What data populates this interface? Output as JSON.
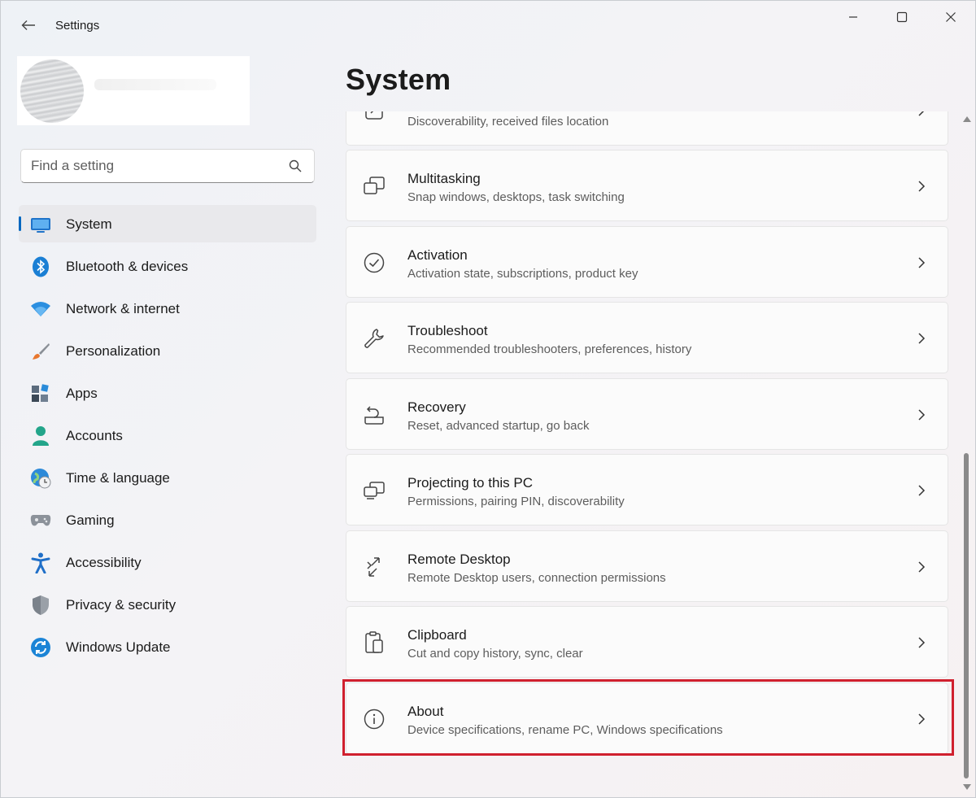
{
  "window": {
    "app_title": "Settings"
  },
  "search": {
    "placeholder": "Find a setting"
  },
  "nav": {
    "items": [
      {
        "label": "System",
        "icon": "system-icon",
        "selected": true
      },
      {
        "label": "Bluetooth & devices",
        "icon": "bluetooth-icon"
      },
      {
        "label": "Network & internet",
        "icon": "wifi-icon"
      },
      {
        "label": "Personalization",
        "icon": "brush-icon"
      },
      {
        "label": "Apps",
        "icon": "apps-icon"
      },
      {
        "label": "Accounts",
        "icon": "accounts-icon"
      },
      {
        "label": "Time & language",
        "icon": "time-language-icon"
      },
      {
        "label": "Gaming",
        "icon": "gamepad-icon"
      },
      {
        "label": "Accessibility",
        "icon": "accessibility-icon"
      },
      {
        "label": "Privacy & security",
        "icon": "shield-icon"
      },
      {
        "label": "Windows Update",
        "icon": "windows-update-icon"
      }
    ]
  },
  "main": {
    "title": "System",
    "cards": [
      {
        "title": "",
        "subtitle": "Discoverability, received files location",
        "icon": "nearby-sharing-icon"
      },
      {
        "title": "Multitasking",
        "subtitle": "Snap windows, desktops, task switching",
        "icon": "multitasking-icon"
      },
      {
        "title": "Activation",
        "subtitle": "Activation state, subscriptions, product key",
        "icon": "activation-icon"
      },
      {
        "title": "Troubleshoot",
        "subtitle": "Recommended troubleshooters, preferences, history",
        "icon": "wrench-icon"
      },
      {
        "title": "Recovery",
        "subtitle": "Reset, advanced startup, go back",
        "icon": "recovery-icon"
      },
      {
        "title": "Projecting to this PC",
        "subtitle": "Permissions, pairing PIN, discoverability",
        "icon": "projecting-icon"
      },
      {
        "title": "Remote Desktop",
        "subtitle": "Remote Desktop users, connection permissions",
        "icon": "remote-desktop-icon"
      },
      {
        "title": "Clipboard",
        "subtitle": "Cut and copy history, sync, clear",
        "icon": "clipboard-icon"
      },
      {
        "title": "About",
        "subtitle": "Device specifications, rename PC, Windows specifications",
        "icon": "info-icon",
        "highlighted": true
      }
    ]
  },
  "colors": {
    "accent": "#0067c0",
    "highlight_border": "#d0202e"
  }
}
